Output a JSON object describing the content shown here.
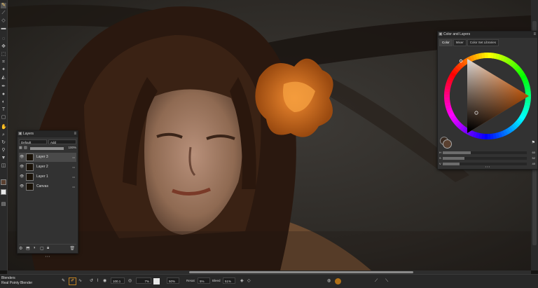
{
  "tools": {
    "items": [
      "brush",
      "eraser-style",
      "smudge",
      "eraser",
      "lasso",
      "move",
      "transform",
      "crop",
      "text",
      "eyedropper",
      "fill",
      "shape",
      "pen",
      "blend",
      "clone",
      "select",
      "rectangle",
      "ellipse",
      "hand",
      "zoom"
    ]
  },
  "layers_panel": {
    "title": "Layers",
    "blend_mode": "Default",
    "composite": "Add",
    "opacity_value": "100%",
    "opacity_fraction": 1.0,
    "items": [
      {
        "name": "Layer 3",
        "selected": true
      },
      {
        "name": "Layer 2",
        "selected": false
      },
      {
        "name": "Layer 1",
        "selected": false
      },
      {
        "name": "Canvas",
        "selected": false
      }
    ],
    "more": "• • •"
  },
  "color_panel": {
    "title": "Color and Layers",
    "tabs": [
      "Color",
      "Mixer",
      "Color Set Libraries"
    ],
    "active_tab": "Color",
    "hue": "#ff6a00",
    "main_color": "#5a4030",
    "sliders": [
      {
        "label": "H",
        "value": "60",
        "fraction": 0.33
      },
      {
        "label": "S",
        "value": "52",
        "fraction": 0.26
      },
      {
        "label": "V",
        "value": "40",
        "fraction": 0.2
      }
    ],
    "more": "• • •"
  },
  "propbar": {
    "brand_top": "Blenders",
    "brand_bottom": "Real Pointy Blender",
    "size_value": "100.1",
    "opacity_value": "7%",
    "grain_value": "50%",
    "resat_label": "Resat",
    "resat_value": "5%",
    "bleed_label": "Bleed",
    "bleed_value": "51%",
    "resat_fraction": 0.05,
    "bleed_fraction": 0.51
  },
  "colors": {
    "accent": "#ff7a10",
    "panel": "#323232",
    "toolbar": "#2a2a2a"
  }
}
